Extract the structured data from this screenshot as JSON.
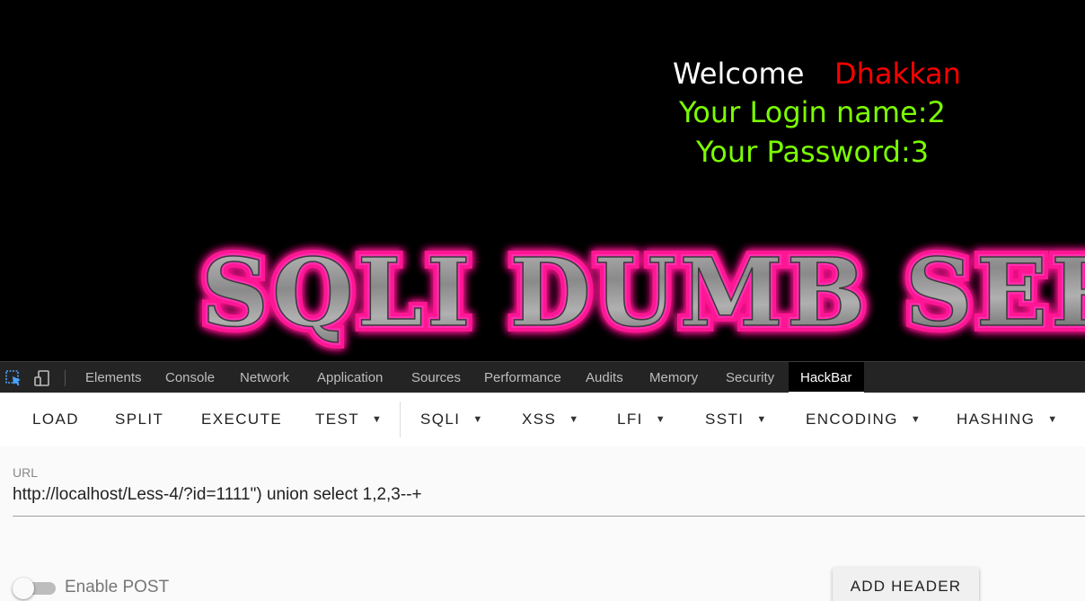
{
  "page": {
    "welcome": "Welcome",
    "username": "Dhakkan",
    "login_name": "Your Login name:2",
    "password": "Your Password:3",
    "banner_text": "SQLI DUMB SERIES"
  },
  "devtools": {
    "tabs": [
      {
        "label": "Elements"
      },
      {
        "label": "Console"
      },
      {
        "label": "Network"
      },
      {
        "label": "Application"
      },
      {
        "label": "Sources"
      },
      {
        "label": "Performance"
      },
      {
        "label": "Audits"
      },
      {
        "label": "Memory"
      },
      {
        "label": "Security"
      },
      {
        "label": "HackBar",
        "active": true
      }
    ],
    "icons": [
      "inspect-element-icon",
      "device-toolbar-icon"
    ]
  },
  "hackbar": {
    "buttons": [
      {
        "label": "LOAD"
      },
      {
        "label": "SPLIT"
      },
      {
        "label": "EXECUTE"
      },
      {
        "label": "TEST",
        "dropdown": true
      },
      {
        "label": "SQLI",
        "dropdown": true
      },
      {
        "label": "XSS",
        "dropdown": true
      },
      {
        "label": "LFI",
        "dropdown": true
      },
      {
        "label": "SSTI",
        "dropdown": true
      },
      {
        "label": "ENCODING",
        "dropdown": true
      },
      {
        "label": "HASHING",
        "dropdown": true
      }
    ],
    "url_label": "URL",
    "url_value": "http://localhost/Less-4/?id=1111\") union select 1,2,3--+",
    "enable_post_label": "Enable POST",
    "enable_post": false,
    "add_header_label": "ADD HEADER"
  },
  "colors": {
    "welcome": "#ffffff",
    "username": "#ff0000",
    "credentials": "#7cfc00",
    "banner_glow": "#ff1493",
    "banner_fill": "#9a9a9a"
  }
}
